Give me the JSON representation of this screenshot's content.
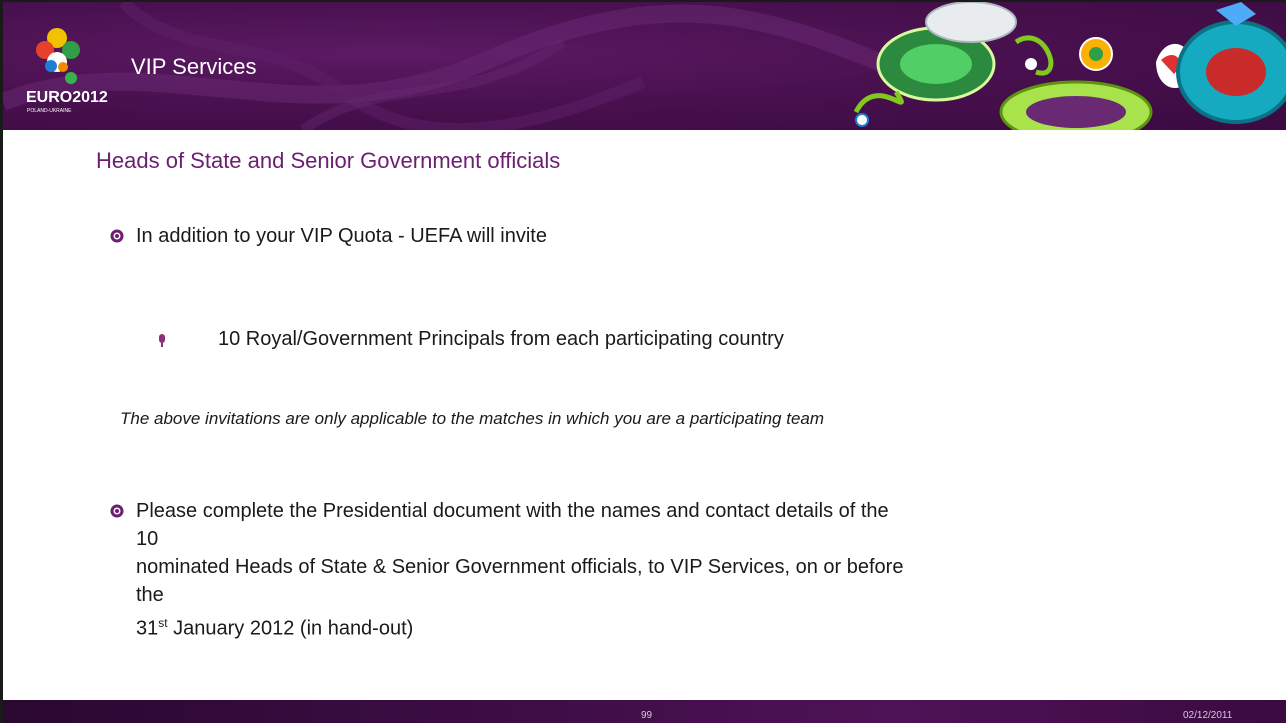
{
  "header": {
    "title": "VIP Services",
    "logo_text": "EURO2012",
    "logo_subtext": "POLAND-UKRAINE"
  },
  "subtitle": "Heads of State and Senior Government officials",
  "bullets": [
    {
      "text": "In addition to your VIP Quota - UEFA will invite"
    }
  ],
  "sub_bullet": {
    "text": "10 Royal/Government Principals from each participating country"
  },
  "note": "The above invitations are only applicable to the matches in which you are a participating team",
  "bullet2": {
    "line1": "Please complete the Presidential document with the names and contact details of the 10",
    "line2": "nominated Heads of State & Senior Government officials, to VIP Services, on or before the",
    "line3_pre": "31",
    "line3_sup": "st",
    "line3_post": " January 2012 (in hand-out)"
  },
  "footer": {
    "page_number": "99",
    "date": "02/12/2011"
  },
  "colors": {
    "brand_purple": "#4a1150",
    "subtitle_purple": "#6b1e72"
  }
}
